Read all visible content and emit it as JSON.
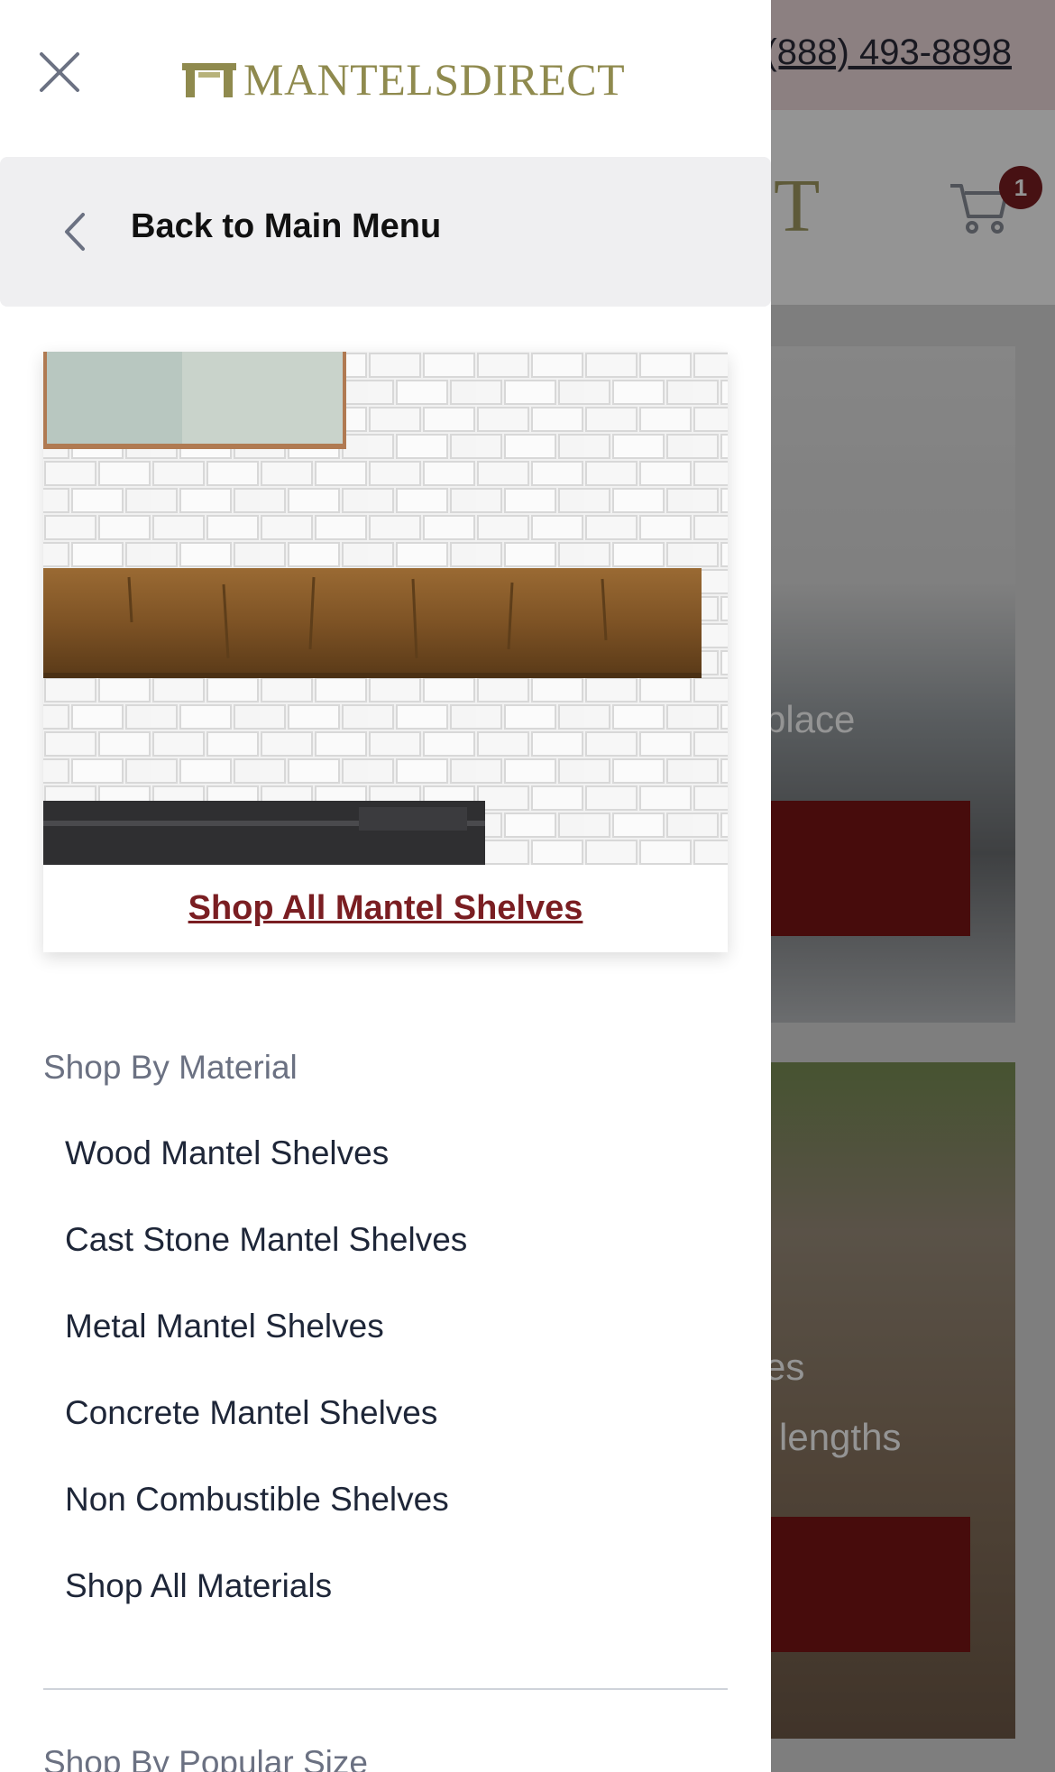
{
  "background_page": {
    "phone": "(888) 493-8898",
    "logo_partial": "CT",
    "cart_count": "1",
    "card1_text": "place",
    "card2_text_line1": "es",
    "card2_text_line2": "lengths"
  },
  "drawer": {
    "logo_text": "MANTELSDIRECT",
    "back_label": "Back to Main Menu",
    "promo": {
      "link_label": "Shop All Mantel Shelves"
    },
    "sections": [
      {
        "title": "Shop By Material",
        "items": [
          "Wood Mantel Shelves",
          "Cast Stone Mantel Shelves",
          "Metal Mantel Shelves",
          "Concrete Mantel Shelves",
          "Non Combustible Shelves",
          "Shop All Materials"
        ]
      },
      {
        "title": "Shop By Popular Size"
      }
    ]
  },
  "colors": {
    "brand_maroon": "#7a1e22",
    "logo_gold": "#8f8a4e",
    "topbar_pink": "#f2dcdf"
  },
  "icons": [
    "close-icon",
    "chevron-left-icon",
    "cart-icon",
    "logo-mark-icon"
  ]
}
